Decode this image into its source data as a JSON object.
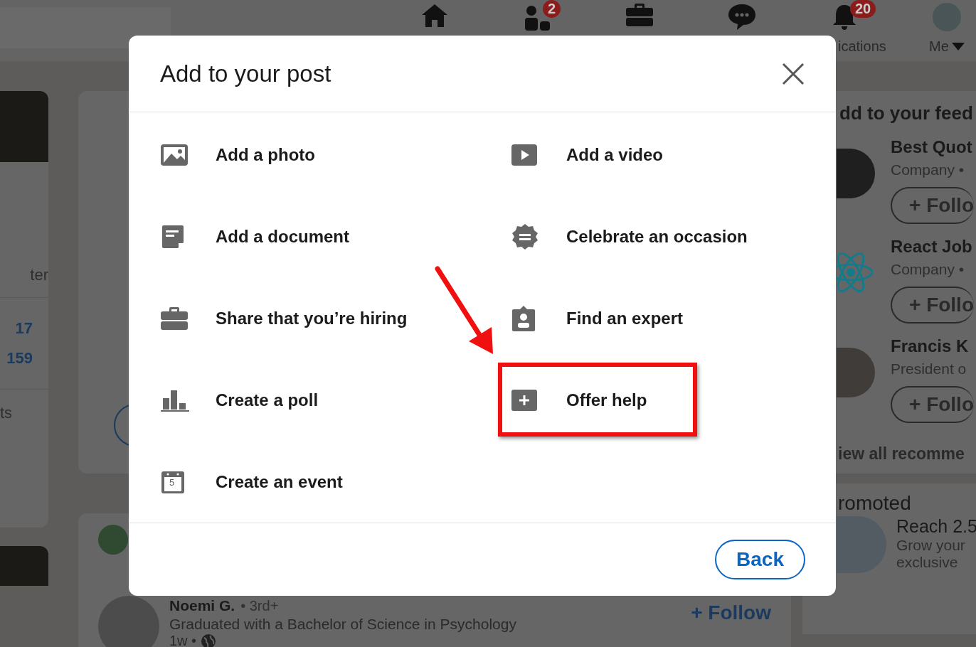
{
  "nav": {
    "network_badge": "2",
    "notifications_badge": "20",
    "notifications_label": "ications",
    "me_label": "Me"
  },
  "left_profile": {
    "name_fragment": "ter",
    "stats": [
      "17",
      "159"
    ],
    "link_fragment": "ts"
  },
  "post": {
    "author": "Noemi G.",
    "degree": "• 3rd+",
    "headline": "Graduated with a Bachelor of Science in Psychology",
    "time": "1w •",
    "follow": "+ Follow"
  },
  "feed_suggestions": {
    "title": "dd to your feed",
    "items": [
      {
        "name": "Best Quot",
        "subtitle": "Company •",
        "follow": "+ Follo"
      },
      {
        "name": "React Job",
        "subtitle": "Company •",
        "follow": "+ Follo"
      },
      {
        "name": "Francis K",
        "subtitle": "President o",
        "follow": "+ Follo"
      }
    ],
    "view_all": "iew all recomme"
  },
  "promoted": {
    "title": "romoted",
    "ad_title": "Reach 2.5",
    "ad_text": "Grow your",
    "ad_text_2": "exclusive"
  },
  "modal": {
    "title": "Add to your post",
    "options": [
      {
        "label": "Add a photo"
      },
      {
        "label": "Add a video"
      },
      {
        "label": "Add a document"
      },
      {
        "label": "Celebrate an occasion"
      },
      {
        "label": "Share that you’re hiring"
      },
      {
        "label": "Find an expert"
      },
      {
        "label": "Create a poll"
      },
      {
        "label": "Offer help"
      },
      {
        "label": "Create an event",
        "icon_text": "5"
      }
    ],
    "back": "Back"
  }
}
